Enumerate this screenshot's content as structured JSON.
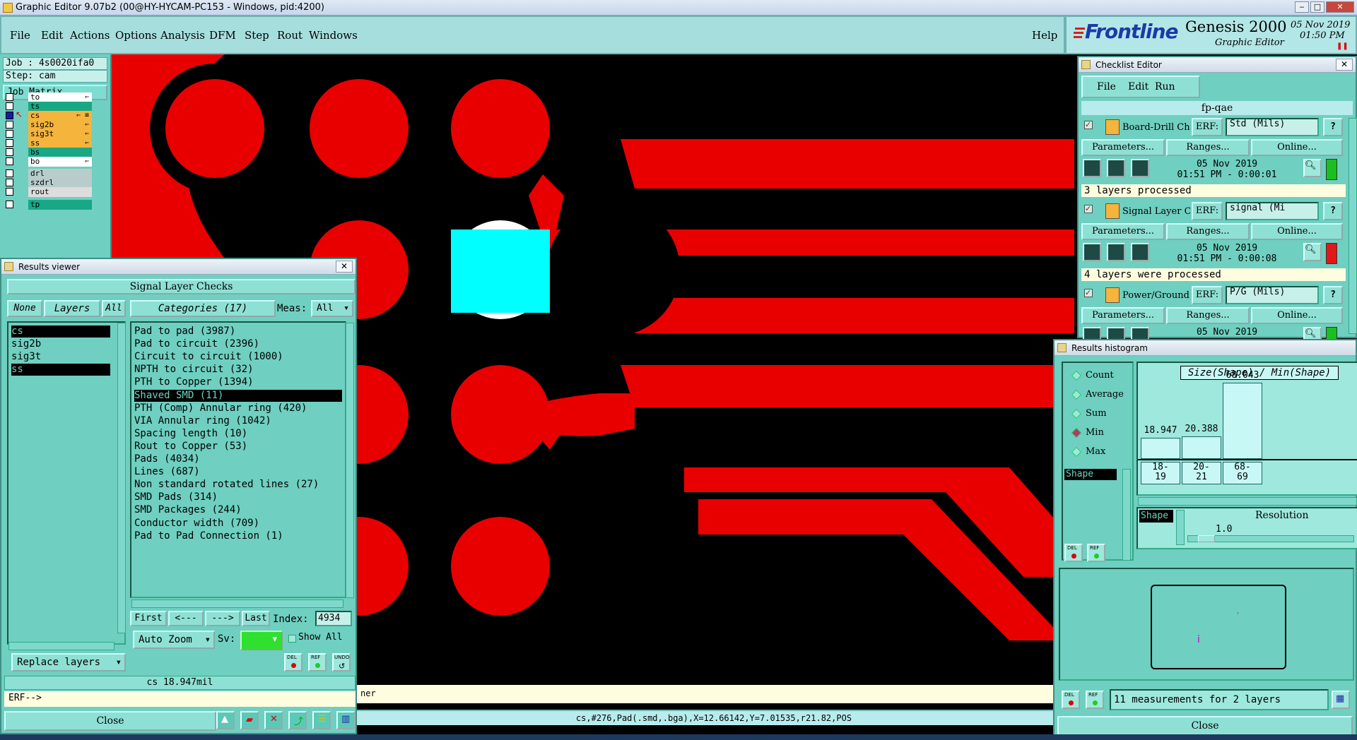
{
  "window": {
    "title": "Graphic Editor 9.07b2 (00@HY-HYCAM-PC153 - Windows, pid:4200)"
  },
  "menu": [
    "File",
    "Edit",
    "Actions",
    "Options",
    "Analysis",
    "DFM",
    "Step",
    "Rout",
    "Windows"
  ],
  "help_label": "Help",
  "brand": {
    "logo_text": "Frontline",
    "product": "Genesis 2000",
    "subtitle": "Graphic Editor",
    "date": "05 Nov 2019",
    "time": "01:50 PM"
  },
  "left_panel": {
    "job": "Job : 4s0020ifa0",
    "step": "Step: cam",
    "job_matrix": "Job Matrix ...",
    "layers": [
      {
        "name": "to",
        "color": "#ffffff",
        "tag": "⇐"
      },
      {
        "name": "ts",
        "color": "#18a886",
        "tag": ""
      },
      {
        "name": "cs",
        "color": "#f5b43c",
        "tag": "⇐ ≡"
      },
      {
        "name": "sig2b",
        "color": "#f5b43c",
        "tag": "⇐"
      },
      {
        "name": "sig3t",
        "color": "#f5b43c",
        "tag": "⇐"
      },
      {
        "name": "ss",
        "color": "#f5b43c",
        "tag": "⇐"
      },
      {
        "name": "bs",
        "color": "#18a886",
        "tag": ""
      },
      {
        "name": "bo",
        "color": "#ffffff",
        "tag": "⇐"
      },
      {
        "name": "drl",
        "color": "#b8cccc",
        "tag": ""
      },
      {
        "name": "szdrl",
        "color": "#b8cccc",
        "tag": ""
      },
      {
        "name": "rout",
        "color": "#dddddd",
        "tag": ""
      },
      {
        "name": "tp",
        "color": "#18a886",
        "tag": ""
      }
    ]
  },
  "results_viewer": {
    "title": "Results viewer",
    "close_x": "✕",
    "header": "Signal Layer Checks",
    "none_label": "None",
    "layers_label": "Layers",
    "all_label": "All",
    "categories_label": "Categories (17)",
    "meas_label": "Meas:",
    "meas_value": "All",
    "layers": [
      "cs",
      "sig2b",
      "sig3t",
      "ss"
    ],
    "categories": [
      "Pad to pad (3987)",
      "Pad to circuit (2396)",
      "Circuit to circuit (1000)",
      "NPTH to circuit (32)",
      "PTH to Copper (1394)",
      "Shaved SMD (11)",
      "PTH (Comp) Annular ring (420)",
      "VIA Annular ring (1042)",
      "Spacing length (10)",
      "Rout to Copper (53)",
      "Pads (4034)",
      "Lines (687)",
      "Non standard rotated lines (27)",
      "SMD Pads (314)",
      "SMD Packages (244)",
      "Conductor width (709)",
      "Pad to Pad Connection (1)"
    ],
    "first_label": "First",
    "prev_label": "<---",
    "next_label": "--->",
    "last_label": "Last",
    "index_label": "Index:",
    "index_value": "4934",
    "auto_zoom": "Auto Zoom",
    "sv_label": "Sv:",
    "show_all": "Show All",
    "replace_layers": "Replace layers",
    "status": "cs 18.947mil",
    "erf_prompt": "ERF-->",
    "close_label": "Close"
  },
  "canvas_status": {
    "strip_text": "ner",
    "coords": "cs,#276,Pad(.smd,.bga),X=12.66142,Y=7.01535,r21.82,POS"
  },
  "checklist": {
    "title": "Checklist Editor",
    "menu": [
      "File",
      "Edit",
      "Run"
    ],
    "name": "fp-qae",
    "erf_label": "ERF:",
    "params_label": "Parameters...",
    "ranges_label": "Ranges...",
    "online_label": "Online...",
    "items": [
      {
        "name": "Board-Drill Che",
        "erf": "Std (Mils)",
        "date": "05 Nov 2019",
        "time": "01:51 PM - 0:00:01",
        "message": "3 layers processed",
        "status_color": "#18c020"
      },
      {
        "name": "Signal Layer Ch",
        "erf": "signal (Mi",
        "date": "05 Nov 2019",
        "time": "01:51 PM - 0:00:08",
        "message": "4 layers were processed",
        "status_color": "#e01818"
      },
      {
        "name": "Power/Ground C",
        "erf": "P/G (Mils)",
        "date": "05 Nov 2019",
        "time": "",
        "message": "",
        "status_color": "#18c020"
      }
    ]
  },
  "histogram": {
    "title": "Results histogram",
    "modes": [
      "Count",
      "Average",
      "Sum",
      "Min",
      "Max"
    ],
    "selected_mode": "Min",
    "axis_item": "Shape",
    "chart_title": "Size(Shape) / Min(Shape)",
    "bars": [
      {
        "range": "18-\n19",
        "value": 18.947,
        "label": "18.947"
      },
      {
        "range": "20-\n21",
        "value": 20.388,
        "label": "20.388"
      },
      {
        "range": "68-\n69",
        "value": 68.043,
        "label": "68.043"
      }
    ],
    "resolution_label": "Resolution",
    "resolution_item": "Shape",
    "resolution_value": "1.0",
    "summary": "11 measurements for 2 layers",
    "close_label": "Close"
  },
  "icons": {
    "del": "DEL",
    "ref": "REF",
    "undo": "UNDO"
  }
}
